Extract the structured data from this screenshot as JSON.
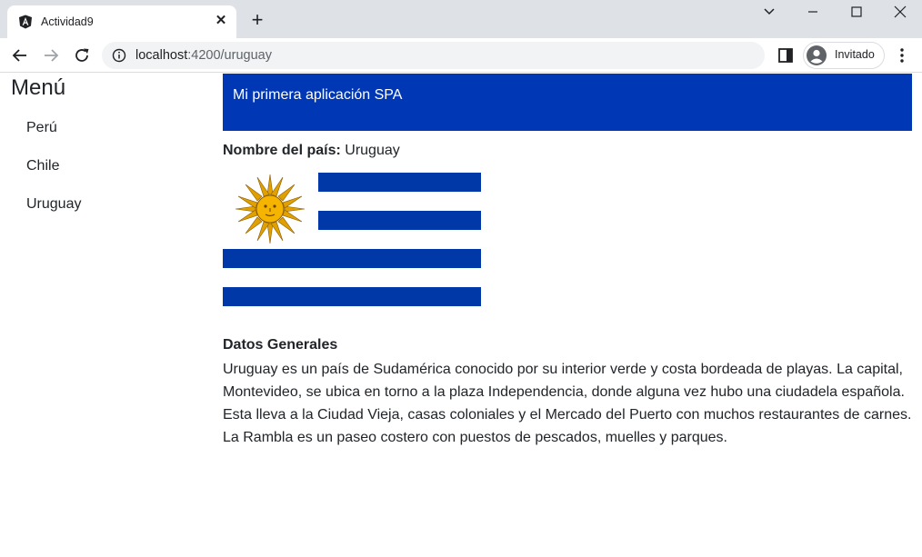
{
  "browser": {
    "tab_title": "Actividad9",
    "tab_close": "✕",
    "new_tab": "+",
    "url_host": "localhost",
    "url_path": ":4200/uruguay",
    "profile_name": "Invitado"
  },
  "menu": {
    "title": "Menú",
    "items": [
      "Perú",
      "Chile",
      "Uruguay"
    ]
  },
  "banner": {
    "text": "Mi primera aplicación SPA",
    "color": "#0037b4"
  },
  "country": {
    "label": "Nombre del país:",
    "name": "Uruguay"
  },
  "flag": {
    "stripe_color": "#0038a8",
    "sun_color": "#f5b400"
  },
  "details": {
    "title": "Datos Generales",
    "body": "Uruguay es un país de Sudamérica conocido por su interior verde y costa bordeada de playas. La capital, Montevideo, se ubica en torno a la plaza Independencia, donde alguna vez hubo una ciudadela española. Esta lleva a la Ciudad Vieja, casas coloniales y el Mercado del Puerto con muchos restaurantes de carnes. La Rambla es un paseo costero con puestos de pescados, muelles y parques."
  }
}
